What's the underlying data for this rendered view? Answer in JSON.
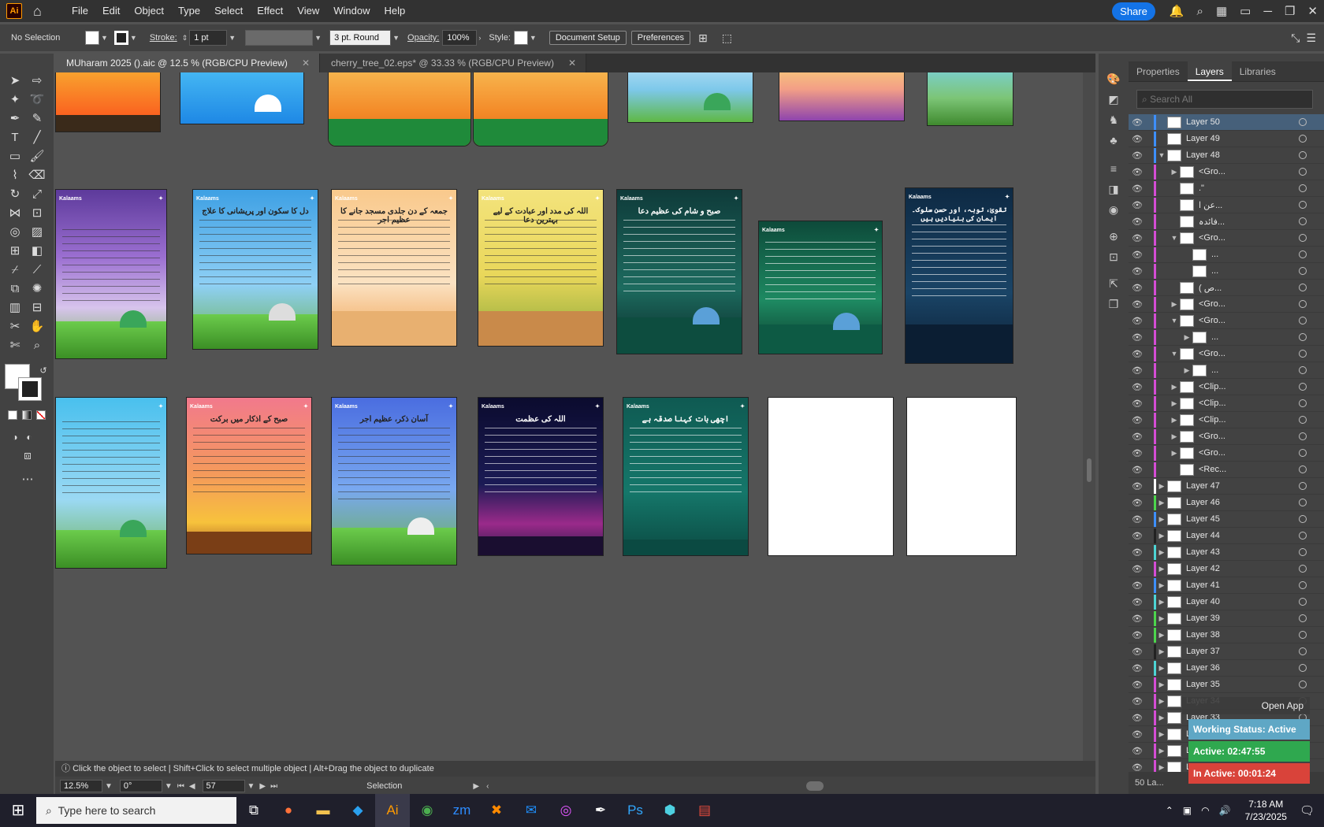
{
  "app": {
    "icon": "Ai"
  },
  "menu": [
    "File",
    "Edit",
    "Object",
    "Type",
    "Select",
    "Effect",
    "View",
    "Window",
    "Help"
  ],
  "menubar_right": {
    "share": "Share"
  },
  "control": {
    "selection": "No Selection",
    "stroke_label": "Stroke:",
    "stroke_value": "1 pt",
    "brush": "3 pt. Round",
    "opacity_label": "Opacity:",
    "opacity_value": "100%",
    "style_label": "Style:",
    "doc_setup": "Document Setup",
    "preferences": "Preferences"
  },
  "tabs": [
    {
      "label": "MUharam 2025 ().aic @ 12.5 % (RGB/CPU Preview)",
      "active": true
    },
    {
      "label": "cherry_tree_02.eps* @ 33.33 % (RGB/CPU Preview)",
      "active": false
    }
  ],
  "artboards": {
    "brand": "Kalaams",
    "titles": [
      "",
      "دل کا سکون اور پریشانی کا علاج",
      "جمعہ کے دن جلدی مسجد جانے کا عظیم اجر",
      "اللہ کی مدد اور عبادت کے لیے بہترین دعا",
      "صبح و شام کی عظیم دعا",
      "",
      "تقویٰ، توبہ، اور حسن سلوک۔ ایمان کی بنیادیں ہیں",
      "",
      "صبح کے اذکار میں برکت",
      "آسان ذکر، عظیم اجر",
      "اللہ کی عظمت",
      "اچھی بات کہنا صدقہ ہے"
    ]
  },
  "status": {
    "hint": "Click the object to select  |  Shift+Click to select multiple object  |  Alt+Drag the object to duplicate",
    "zoom": "12.5%",
    "rotate": "0°",
    "artboard_num": "57",
    "tool": "Selection"
  },
  "panel": {
    "tabs": [
      "Properties",
      "Layers",
      "Libraries"
    ],
    "search_placeholder": "Search All",
    "layers": [
      {
        "name": "Layer 50",
        "color": "#3d8fff",
        "sel": true,
        "tw": ""
      },
      {
        "name": "Layer 49",
        "color": "#3d8fff",
        "tw": ""
      },
      {
        "name": "Layer 48",
        "color": "#3d8fff",
        "tw": "open"
      },
      {
        "name": "<Gro...",
        "color": "#d54dd5",
        "tw": "closed",
        "indent": 1
      },
      {
        "name": ".\"",
        "color": "#d54dd5",
        "tw": "",
        "indent": 1
      },
      {
        "name": "عن ا...",
        "color": "#d54dd5",
        "tw": "",
        "indent": 1
      },
      {
        "name": "فائدہ...",
        "color": "#d54dd5",
        "tw": "",
        "indent": 1
      },
      {
        "name": "<Gro...",
        "color": "#d54dd5",
        "tw": "open",
        "indent": 1
      },
      {
        "name": "...",
        "color": "#d54dd5",
        "tw": "",
        "indent": 2
      },
      {
        "name": "...",
        "color": "#d54dd5",
        "tw": "",
        "indent": 2
      },
      {
        "name": "( ص...",
        "color": "#d54dd5",
        "tw": "",
        "indent": 1
      },
      {
        "name": "<Gro...",
        "color": "#d54dd5",
        "tw": "closed",
        "indent": 1
      },
      {
        "name": "<Gro...",
        "color": "#d54dd5",
        "tw": "open",
        "indent": 1
      },
      {
        "name": "...",
        "color": "#d54dd5",
        "tw": "closed",
        "indent": 2
      },
      {
        "name": "<Gro...",
        "color": "#d54dd5",
        "tw": "open",
        "indent": 1
      },
      {
        "name": "...",
        "color": "#d54dd5",
        "tw": "closed",
        "indent": 2
      },
      {
        "name": "<Clip...",
        "color": "#d54dd5",
        "tw": "closed",
        "indent": 1
      },
      {
        "name": "<Clip...",
        "color": "#d54dd5",
        "tw": "closed",
        "indent": 1
      },
      {
        "name": "<Clip...",
        "color": "#d54dd5",
        "tw": "closed",
        "indent": 1
      },
      {
        "name": "<Gro...",
        "color": "#d54dd5",
        "tw": "closed",
        "indent": 1
      },
      {
        "name": "<Gro...",
        "color": "#d54dd5",
        "tw": "closed",
        "indent": 1
      },
      {
        "name": "<Rec...",
        "color": "#d54dd5",
        "tw": "",
        "indent": 1
      },
      {
        "name": "Layer 47",
        "color": "#ffffff",
        "tw": "closed"
      },
      {
        "name": "Layer 46",
        "color": "#4dd54d",
        "tw": "closed"
      },
      {
        "name": "Layer 45",
        "color": "#3d8fff",
        "tw": "closed"
      },
      {
        "name": "Layer 44",
        "color": "#222222",
        "tw": "closed"
      },
      {
        "name": "Layer 43",
        "color": "#4dd5d5",
        "tw": "closed"
      },
      {
        "name": "Layer 42",
        "color": "#d54dd5",
        "tw": "closed"
      },
      {
        "name": "Layer 41",
        "color": "#3d8fff",
        "tw": "closed"
      },
      {
        "name": "Layer 40",
        "color": "#4dd5d5",
        "tw": "closed"
      },
      {
        "name": "Layer 39",
        "color": "#4dd54d",
        "tw": "closed"
      },
      {
        "name": "Layer 38",
        "color": "#4dd54d",
        "tw": "closed"
      },
      {
        "name": "Layer 37",
        "color": "#222222",
        "tw": "closed"
      },
      {
        "name": "Layer 36",
        "color": "#4dd5d5",
        "tw": "closed"
      },
      {
        "name": "Layer 35",
        "color": "#d54dd5",
        "tw": "closed"
      },
      {
        "name": "Layer 34",
        "color": "#d54dd5",
        "tw": "closed"
      },
      {
        "name": "Layer 33",
        "color": "#d54dd5",
        "tw": "closed"
      },
      {
        "name": "Layer 32",
        "color": "#d54dd5",
        "tw": "closed"
      },
      {
        "name": "Layer 31",
        "color": "#d54dd5",
        "tw": "closed"
      },
      {
        "name": "Layer 30",
        "color": "#d54dd5",
        "tw": "closed"
      }
    ],
    "footer": "50 La..."
  },
  "overlay": {
    "open_app": "Open App",
    "working": "Working Status: Active",
    "active": "Active: 02:47:55",
    "inactive": "In Active: 00:01:24"
  },
  "taskbar": {
    "search": "Type here to search",
    "time": "7:18 AM",
    "date": "7/23/2025"
  }
}
